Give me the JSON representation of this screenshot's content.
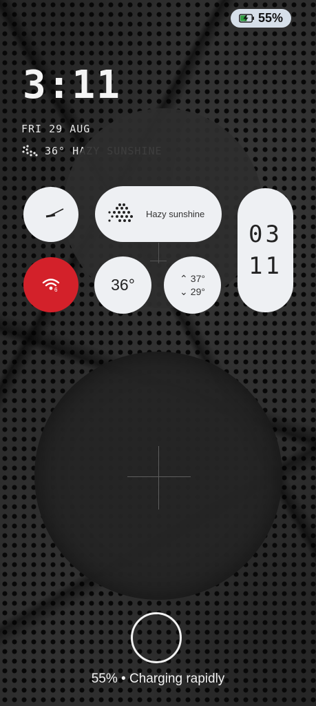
{
  "status_bar": {
    "battery_percent": "55%",
    "charging_color": "#2e9e3e"
  },
  "lockscreen": {
    "time": "3:11",
    "date": "FRI 29 AUG",
    "weather": "36° HAZY SUNSHINE"
  },
  "widgets": {
    "weather_label": "Hazy sunshine",
    "temperature": "36°",
    "high": "37°",
    "low": "29°",
    "date_month": "03",
    "date_day": "11",
    "accent_red": "#d3212a"
  },
  "footer": {
    "charging_text": "55% • Charging rapidly"
  }
}
